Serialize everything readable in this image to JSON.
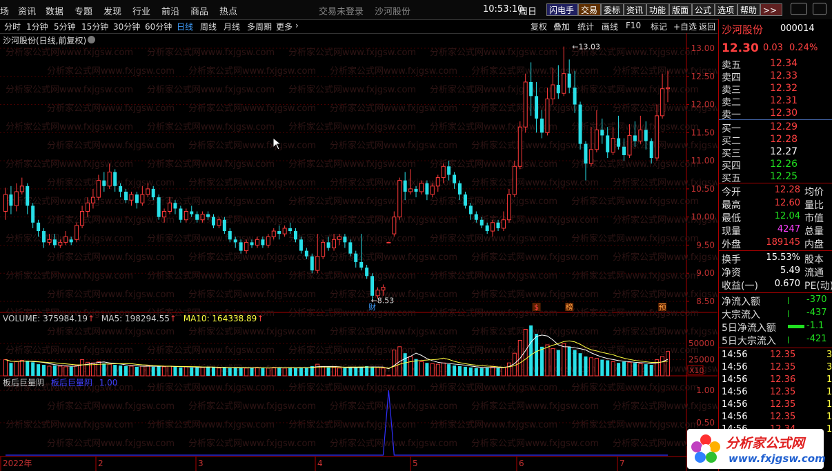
{
  "menubar": {
    "items": [
      "场",
      "资讯",
      "数据",
      "专题",
      "发现",
      "行业",
      "前沿",
      "商品",
      "热点"
    ],
    "login_status": "交易未登录",
    "stock_name_center": "沙河股份",
    "time": "10:53:10",
    "weekday": "周日",
    "buttons": [
      "闪电手",
      "交易",
      "委标",
      "资讯",
      "功能",
      "版面",
      "公式",
      "选项",
      "帮助"
    ],
    "more": ">>"
  },
  "periodbar": {
    "periods": [
      "分时",
      "1分钟",
      "5分钟",
      "15分钟",
      "30分钟",
      "60分钟",
      "日线",
      "周线",
      "月线",
      "多周期",
      "更多"
    ],
    "active": "日线",
    "tools": [
      "复权",
      "叠加",
      "统计",
      "画线",
      "F10",
      "标记",
      "+自选",
      "返回"
    ]
  },
  "chart_title": "沙河股份(日线,前复权)",
  "price_axis": [
    "13.00",
    "12.50",
    "12.00",
    "11.50",
    "11.00",
    "10.50",
    "10.00",
    "9.50",
    "9.00",
    "8.50"
  ],
  "annotations": {
    "high": "13.03",
    "low": "8.53",
    "markers": [
      "财",
      "$",
      "榜",
      "预"
    ]
  },
  "volume_panel": {
    "label": "VOLUME: 375984.19",
    "ma5": "MA5: 198294.55",
    "ma10": "MA10: 164338.89",
    "axis": [
      "50000",
      "25000"
    ],
    "unit": "X10"
  },
  "indicator_panel": {
    "name": "板后巨量阴",
    "line_label": "板后巨量阴",
    "value": "1.00",
    "axis": [
      "1.00",
      "0.50"
    ]
  },
  "x_axis": [
    "2022年",
    "2",
    "3",
    "4",
    "5",
    "6",
    "7"
  ],
  "watermark": "分析家公式网www.fxjgsw.com",
  "quote": {
    "name": "沙河股份",
    "code": "000014",
    "price": "12.30",
    "change": "0.03",
    "change_pct": "0.24%",
    "asks": [
      {
        "label": "卖五",
        "price": "12.34"
      },
      {
        "label": "卖四",
        "price": "12.33"
      },
      {
        "label": "卖三",
        "price": "12.32"
      },
      {
        "label": "卖二",
        "price": "12.31"
      },
      {
        "label": "卖一",
        "price": "12.30"
      }
    ],
    "bids": [
      {
        "label": "买一",
        "price": "12.29"
      },
      {
        "label": "买二",
        "price": "12.28"
      },
      {
        "label": "买三",
        "price": "12.27"
      },
      {
        "label": "买四",
        "price": "12.26"
      },
      {
        "label": "买五",
        "price": "12.25"
      }
    ],
    "stats": [
      {
        "label": "今开",
        "value": "12.28",
        "label2": "均价"
      },
      {
        "label": "最高",
        "value": "12.60",
        "label2": "量比"
      },
      {
        "label": "最低",
        "value": "12.04",
        "label2": "市值"
      },
      {
        "label": "现量",
        "value": "4247",
        "label2": "总量"
      },
      {
        "label": "外盘",
        "value": "189145",
        "label2": "内盘"
      }
    ],
    "stats2": [
      {
        "label": "换手",
        "value": "15.53%",
        "label2": "股本"
      },
      {
        "label": "净资",
        "value": "5.49",
        "label2": "流通"
      },
      {
        "label": "收益(一)",
        "value": "0.670",
        "label2": "PE(动)"
      }
    ],
    "flows": [
      {
        "label": "净流入额",
        "value": "-370"
      },
      {
        "label": "大宗流入",
        "value": "-437"
      },
      {
        "label": "5日净流入额",
        "value": "-1.1"
      },
      {
        "label": "5日大宗流入",
        "value": "-421"
      }
    ],
    "ticks": [
      {
        "time": "14:56",
        "price": "12.35",
        "vol": "3"
      },
      {
        "time": "14:56",
        "price": "12.35",
        "vol": "3"
      },
      {
        "time": "14:56",
        "price": "12.36",
        "vol": "1"
      },
      {
        "time": "14:56",
        "price": "12.35",
        "vol": "1"
      },
      {
        "time": "14:56",
        "price": "12.35",
        "vol": "1"
      },
      {
        "time": "14:56",
        "price": "12.35",
        "vol": "1"
      },
      {
        "time": "14:56",
        "price": "12.34",
        "vol": "1"
      }
    ]
  },
  "logo": {
    "title": "分析家公式网",
    "url": "www.fxjgsw.com"
  },
  "chart_data": {
    "type": "candlestick",
    "title": "沙河股份(日线,前复权)",
    "ylim": [
      8.3,
      13.2
    ],
    "candles": [
      [
        10.1,
        10.4,
        10.52,
        9.95
      ],
      [
        10.4,
        10.2,
        10.55,
        10.05
      ],
      [
        10.2,
        10.45,
        10.6,
        10.1
      ],
      [
        10.45,
        10.55,
        10.7,
        10.4
      ],
      [
        10.55,
        10.2,
        10.6,
        10.05
      ],
      [
        10.2,
        9.9,
        10.25,
        9.8
      ],
      [
        9.9,
        9.75,
        9.95,
        9.65
      ],
      [
        9.75,
        9.55,
        9.8,
        9.45
      ],
      [
        9.55,
        9.6,
        9.7,
        9.5
      ],
      [
        9.6,
        9.5,
        9.7,
        9.45
      ],
      [
        9.5,
        9.55,
        9.6,
        9.45
      ],
      [
        9.55,
        9.65,
        9.75,
        9.5
      ],
      [
        9.6,
        9.55,
        9.65,
        9.5
      ],
      [
        9.6,
        9.85,
        9.9,
        9.55
      ],
      [
        9.85,
        10.1,
        10.2,
        9.8
      ],
      [
        10.1,
        10.25,
        10.35,
        10.0
      ],
      [
        10.25,
        10.35,
        10.5,
        10.15
      ],
      [
        10.35,
        10.65,
        10.75,
        10.3
      ],
      [
        10.65,
        10.55,
        10.8,
        10.45
      ],
      [
        10.55,
        10.8,
        10.95,
        10.5
      ],
      [
        10.8,
        10.55,
        10.85,
        10.45
      ],
      [
        10.55,
        10.45,
        10.6,
        10.35
      ],
      [
        10.45,
        10.3,
        10.5,
        10.25
      ],
      [
        10.3,
        10.4,
        10.45,
        10.2
      ],
      [
        10.4,
        10.25,
        10.45,
        10.15
      ],
      [
        10.25,
        10.4,
        10.55,
        10.2
      ],
      [
        10.4,
        10.5,
        10.6,
        10.35
      ],
      [
        10.5,
        10.35,
        10.55,
        10.3
      ],
      [
        10.35,
        10.0,
        10.4,
        9.95
      ],
      [
        10.0,
        10.1,
        10.15,
        9.9
      ],
      [
        10.1,
        10.25,
        10.35,
        10.05
      ],
      [
        10.25,
        10.15,
        10.3,
        10.05
      ],
      [
        10.15,
        9.95,
        10.2,
        9.9
      ],
      [
        9.95,
        10.1,
        10.15,
        9.9
      ],
      [
        10.1,
        10.05,
        10.2,
        10.0
      ],
      [
        10.05,
        9.95,
        10.1,
        9.9
      ],
      [
        9.95,
        10.05,
        10.1,
        9.9
      ],
      [
        10.05,
        10.0,
        10.1,
        9.95
      ],
      [
        10.0,
        9.85,
        10.05,
        9.8
      ],
      [
        9.85,
        9.95,
        10.0,
        9.8
      ],
      [
        9.95,
        9.75,
        10.0,
        9.7
      ],
      [
        9.75,
        9.6,
        9.8,
        9.55
      ],
      [
        9.6,
        9.55,
        9.65,
        9.45
      ],
      [
        9.55,
        9.4,
        9.6,
        9.35
      ],
      [
        9.4,
        9.55,
        9.6,
        9.35
      ],
      [
        9.55,
        9.5,
        9.6,
        9.45
      ],
      [
        9.5,
        9.6,
        9.65,
        9.45
      ],
      [
        9.6,
        9.5,
        9.65,
        9.45
      ],
      [
        9.5,
        9.65,
        9.7,
        9.45
      ],
      [
        9.65,
        9.75,
        9.8,
        9.6
      ],
      [
        9.75,
        9.7,
        9.85,
        9.6
      ],
      [
        9.7,
        9.8,
        9.85,
        9.65
      ],
      [
        9.8,
        9.75,
        9.9,
        9.7
      ],
      [
        9.75,
        9.6,
        9.8,
        9.55
      ],
      [
        9.6,
        9.4,
        9.65,
        9.35
      ],
      [
        9.4,
        9.3,
        9.45,
        9.25
      ],
      [
        9.3,
        9.05,
        9.35,
        9.0
      ],
      [
        9.05,
        9.3,
        9.7,
        9.0
      ],
      [
        9.3,
        9.55,
        9.6,
        9.25
      ],
      [
        9.55,
        9.45,
        9.65,
        9.4
      ],
      [
        9.45,
        9.6,
        9.7,
        9.4
      ],
      [
        9.6,
        9.65,
        9.7,
        9.5
      ],
      [
        9.65,
        9.55,
        9.7,
        9.45
      ],
      [
        9.55,
        9.35,
        9.6,
        9.3
      ],
      [
        9.35,
        9.2,
        9.4,
        9.1
      ],
      [
        9.2,
        9.1,
        9.7,
        9.05
      ],
      [
        9.1,
        8.95,
        9.15,
        8.9
      ],
      [
        8.95,
        8.6,
        9.0,
        8.53
      ],
      [
        8.6,
        8.7,
        8.75,
        8.55
      ],
      [
        8.7,
        8.75,
        8.8,
        8.6
      ],
      [
        9.55,
        9.55,
        9.56,
        9.54
      ],
      [
        9.7,
        10.0,
        10.1,
        9.65
      ],
      [
        10.0,
        10.65,
        10.7,
        9.95
      ],
      [
        10.65,
        10.45,
        10.8,
        10.3
      ],
      [
        10.45,
        10.5,
        10.85,
        10.4
      ],
      [
        10.5,
        10.45,
        10.55,
        10.35
      ],
      [
        10.45,
        10.6,
        10.65,
        10.4
      ],
      [
        10.6,
        10.4,
        10.65,
        10.3
      ],
      [
        10.4,
        10.55,
        10.6,
        10.35
      ],
      [
        10.55,
        10.7,
        10.75,
        10.45
      ],
      [
        10.7,
        10.9,
        10.95,
        10.6
      ],
      [
        10.9,
        10.75,
        11.0,
        10.65
      ],
      [
        10.75,
        10.6,
        10.8,
        10.5
      ],
      [
        10.6,
        10.4,
        10.65,
        10.3
      ],
      [
        10.4,
        10.2,
        10.45,
        10.15
      ],
      [
        10.2,
        10.05,
        10.25,
        9.95
      ],
      [
        10.05,
        9.95,
        10.1,
        9.9
      ],
      [
        9.95,
        9.85,
        10.0,
        9.8
      ],
      [
        9.85,
        9.75,
        9.9,
        9.7
      ],
      [
        9.75,
        9.9,
        9.95,
        9.65
      ],
      [
        9.9,
        9.8,
        9.95,
        9.75
      ],
      [
        9.8,
        9.95,
        10.1,
        9.75
      ],
      [
        9.95,
        10.4,
        10.5,
        9.9
      ],
      [
        10.4,
        10.9,
        11.0,
        10.35
      ],
      [
        10.9,
        11.6,
        11.7,
        10.85
      ],
      [
        11.6,
        12.4,
        12.55,
        11.5
      ],
      [
        12.4,
        12.15,
        12.75,
        11.8
      ],
      [
        12.15,
        11.75,
        12.4,
        11.5
      ],
      [
        11.75,
        11.5,
        11.9,
        11.4
      ],
      [
        11.5,
        12.1,
        12.3,
        11.45
      ],
      [
        12.1,
        12.35,
        12.65,
        12.0
      ],
      [
        12.35,
        12.2,
        12.7,
        12.1
      ],
      [
        12.2,
        12.55,
        13.03,
        12.15
      ],
      [
        12.55,
        12.3,
        12.8,
        12.2
      ],
      [
        12.3,
        12.0,
        12.6,
        11.85
      ],
      [
        12.0,
        11.3,
        12.05,
        11.2
      ],
      [
        11.3,
        10.95,
        11.35,
        10.65
      ],
      [
        10.95,
        11.2,
        11.6,
        10.9
      ],
      [
        11.2,
        11.55,
        11.9,
        11.15
      ],
      [
        11.55,
        11.45,
        11.75,
        11.3
      ],
      [
        11.45,
        11.15,
        11.6,
        11.05
      ],
      [
        11.15,
        11.4,
        11.6,
        11.1
      ],
      [
        11.4,
        11.25,
        11.8,
        11.2
      ],
      [
        11.25,
        11.1,
        11.4,
        11.0
      ],
      [
        11.1,
        11.45,
        11.65,
        11.05
      ],
      [
        11.45,
        11.35,
        11.7,
        11.25
      ],
      [
        11.35,
        11.55,
        11.8,
        11.3
      ],
      [
        11.55,
        11.35,
        11.7,
        11.2
      ],
      [
        11.35,
        11.05,
        11.4,
        10.95
      ],
      [
        11.05,
        11.8,
        12.0,
        11.0
      ],
      [
        11.8,
        12.28,
        12.55,
        11.75
      ],
      [
        12.28,
        12.3,
        12.6,
        12.04
      ]
    ],
    "volume": [
      25,
      20,
      22,
      24,
      23,
      21,
      18,
      17,
      15,
      16,
      15,
      14,
      14,
      16,
      25,
      21,
      20,
      22,
      19,
      18,
      17,
      16,
      15,
      15,
      14,
      15,
      16,
      14,
      15,
      14,
      15,
      14,
      13,
      14,
      13,
      13,
      13,
      14,
      13,
      12,
      13,
      12,
      12,
      13,
      12,
      12,
      13,
      12,
      12,
      13,
      13,
      12,
      13,
      12,
      13,
      13,
      15,
      18,
      14,
      13,
      13,
      12,
      12,
      13,
      13,
      14,
      15,
      14,
      13,
      12,
      1,
      40,
      45,
      35,
      30,
      26,
      22,
      20,
      19,
      18,
      20,
      18,
      16,
      15,
      14,
      13,
      12,
      12,
      13,
      14,
      12,
      13,
      20,
      35,
      55,
      72,
      78,
      65,
      45,
      48,
      42,
      40,
      50,
      45,
      40,
      35,
      30,
      28,
      27,
      25,
      24,
      22,
      20,
      22,
      21,
      20,
      19,
      18,
      17,
      25,
      30,
      37.6
    ],
    "indicator_spikes": [
      70,
      122
    ]
  }
}
